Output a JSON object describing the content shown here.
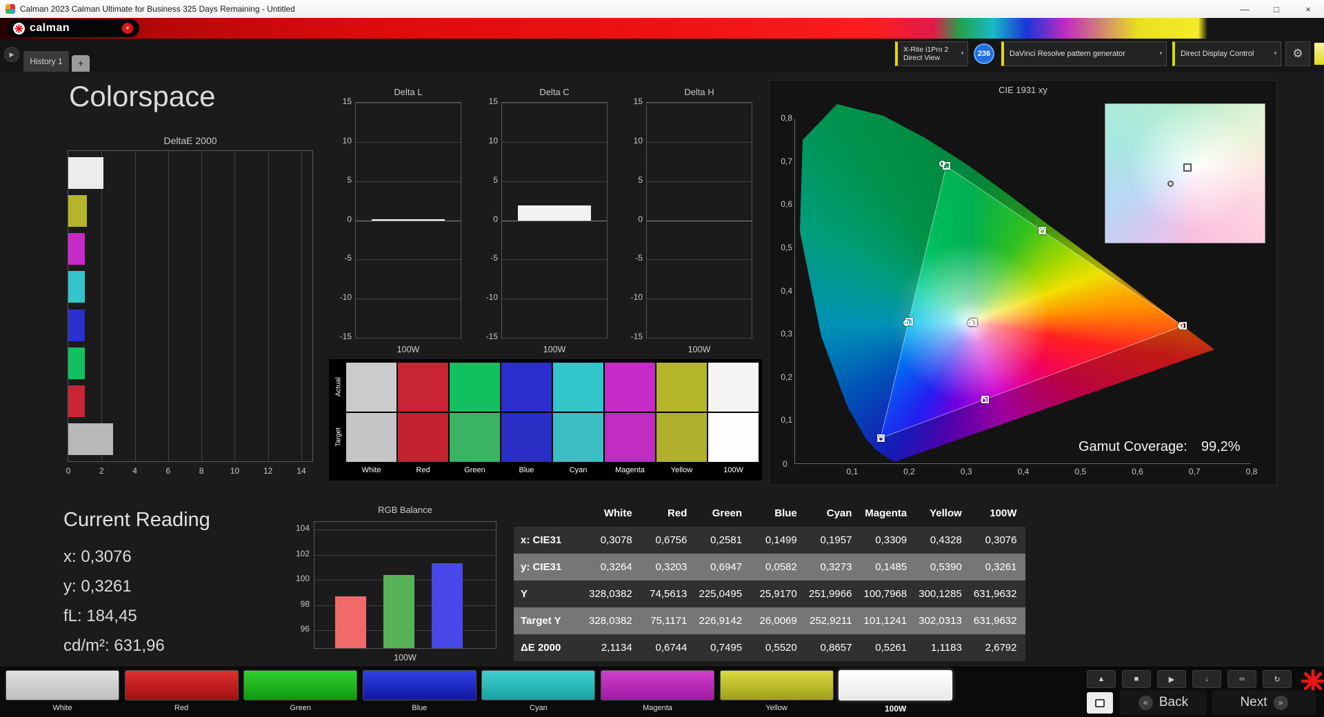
{
  "titlebar": {
    "title": "Calman 2023 Calman Ultimate for Business 325 Days Remaining  - Untitled",
    "minimize_glyph": "—",
    "maximize_glyph": "□",
    "close_glyph": "×"
  },
  "logo": {
    "text": "calman"
  },
  "tabs": {
    "history": "History 1",
    "add": "+"
  },
  "toolbar": {
    "meter": {
      "line1": "X-Rite i1Pro 2",
      "line2": "Direct View"
    },
    "badge": "236",
    "pattern_generator": "DaVinci Resolve pattern generator",
    "display_control": "Direct Display Control"
  },
  "icons": {
    "chevron_down": "▼",
    "play": "▶",
    "gear": "⚙",
    "back_chevrons": "«",
    "next_chevrons": "»"
  },
  "page": {
    "title": "Colorspace"
  },
  "current_reading": {
    "title": "Current Reading",
    "lines": [
      {
        "label": "x:",
        "value": "0,3076"
      },
      {
        "label": "y:",
        "value": "0,3261"
      },
      {
        "label": "fL:",
        "value": "184,45"
      },
      {
        "label": "cd/m²:",
        "value": "631,96"
      }
    ]
  },
  "swatch_comparison": {
    "row_labels": [
      "Actual",
      "Target"
    ],
    "columns": [
      {
        "label": "White",
        "actual": "#cbcbcb",
        "target": "#c5c5c5"
      },
      {
        "label": "Red",
        "actual": "#c92433",
        "target": "#c32331"
      },
      {
        "label": "Green",
        "actual": "#12c05f",
        "target": "#3ab463"
      },
      {
        "label": "Blue",
        "actual": "#2b2fcd",
        "target": "#2a2ec4"
      },
      {
        "label": "Cyan",
        "actual": "#32c5c9",
        "target": "#3cbec2"
      },
      {
        "label": "Magenta",
        "actual": "#c72bc7",
        "target": "#c12cc1"
      },
      {
        "label": "Yellow",
        "actual": "#b5b52a",
        "target": "#b0b02d"
      },
      {
        "label": "100W",
        "actual": "#f4f4f4",
        "target": "#fdfdfd"
      }
    ]
  },
  "pattern_bar": {
    "buttons": [
      {
        "label": "White",
        "color1": "#e2e2e2",
        "color2": "#bdbdbd",
        "selected": false
      },
      {
        "label": "Red",
        "color1": "#e03030",
        "color2": "#a01010",
        "selected": false
      },
      {
        "label": "Green",
        "color1": "#30d030",
        "color2": "#109810",
        "selected": false
      },
      {
        "label": "Blue",
        "color1": "#3040e8",
        "color2": "#1018a0",
        "selected": false
      },
      {
        "label": "Cyan",
        "color1": "#40d0d0",
        "color2": "#18a0a0",
        "selected": false
      },
      {
        "label": "Magenta",
        "color1": "#d040d0",
        "color2": "#a018a0",
        "selected": false
      },
      {
        "label": "Yellow",
        "color1": "#d8d840",
        "color2": "#a0a018",
        "selected": false
      },
      {
        "label": "100W",
        "color1": "#ffffff",
        "color2": "#e8e8e8",
        "selected": true
      }
    ]
  },
  "transport": {
    "buttons": [
      {
        "name": "up-arrow",
        "glyph": "▲"
      },
      {
        "name": "stop",
        "glyph": "■"
      },
      {
        "name": "play",
        "glyph": "▶"
      },
      {
        "name": "save",
        "glyph": "↓"
      },
      {
        "name": "link",
        "glyph": "∞"
      },
      {
        "name": "refresh",
        "glyph": "↻"
      }
    ],
    "back_label": "Back",
    "next_label": "Next"
  },
  "chart_data": [
    {
      "id": "deltaE2000",
      "type": "bar",
      "orientation": "horizontal",
      "title": "DeltaE 2000",
      "categories": [
        "White",
        "Yellow",
        "Magenta",
        "Cyan",
        "Blue",
        "Green",
        "Red",
        "100W"
      ],
      "values": [
        2.1134,
        1.1183,
        0.5261,
        0.8657,
        0.552,
        0.7495,
        0.6744,
        2.6792
      ],
      "colors": [
        "#ececec",
        "#b5b52a",
        "#c72bc7",
        "#32c5c9",
        "#2b2fcd",
        "#12c05f",
        "#c92433",
        "#b8b8b8"
      ],
      "xlim": [
        0,
        14
      ],
      "xticks": [
        0,
        2,
        4,
        6,
        8,
        10,
        12,
        14
      ],
      "grid": true
    },
    {
      "id": "deltaL",
      "type": "bar",
      "title": "Delta L",
      "categories": [
        "100W"
      ],
      "values": [
        0.12
      ],
      "ylim": [
        -15,
        15
      ],
      "yticks": [
        15,
        10,
        5,
        0,
        -5,
        -10,
        -15
      ],
      "xlabel": "100W",
      "bar_color": "#f2f2f2"
    },
    {
      "id": "deltaC",
      "type": "bar",
      "title": "Delta C",
      "categories": [
        "100W"
      ],
      "values": [
        1.9
      ],
      "ylim": [
        -15,
        15
      ],
      "yticks": [
        15,
        10,
        5,
        0,
        -5,
        -10,
        -15
      ],
      "xlabel": "100W",
      "bar_color": "#f2f2f2"
    },
    {
      "id": "deltaH",
      "type": "bar",
      "title": "Delta H",
      "categories": [
        "100W"
      ],
      "values": [
        0.0
      ],
      "ylim": [
        -15,
        15
      ],
      "yticks": [
        15,
        10,
        5,
        0,
        -5,
        -10,
        -15
      ],
      "xlabel": "100W",
      "bar_color": "#f2f2f2"
    },
    {
      "id": "rgbBalance",
      "type": "bar",
      "title": "RGB Balance",
      "categories": [
        "Red",
        "Green",
        "Blue"
      ],
      "values": [
        98.7,
        100.4,
        101.3
      ],
      "colors": [
        "#f06a6a",
        "#58b258",
        "#4848e8"
      ],
      "ylim": [
        94.6,
        104.6
      ],
      "yticks": [
        96,
        98,
        100,
        102,
        104
      ],
      "xlabel": "100W",
      "grid": true
    },
    {
      "id": "cie1931",
      "type": "scatter",
      "title": "CIE 1931 xy",
      "xlim": [
        0,
        0.8
      ],
      "ylim": [
        0,
        0.8
      ],
      "ticks": [
        0.1,
        0.2,
        0.3,
        0.4,
        0.5,
        0.6,
        0.7,
        0.8
      ],
      "origin_label": "0",
      "gamut_triangle": [
        [
          0.68,
          0.32
        ],
        [
          0.265,
          0.69
        ],
        [
          0.15,
          0.06
        ]
      ],
      "points": [
        {
          "name": "White",
          "measured": [
            0.3078,
            0.3264
          ],
          "target": [
            0.3127,
            0.329
          ]
        },
        {
          "name": "Red",
          "measured": [
            0.6756,
            0.3203
          ],
          "target": [
            0.68,
            0.32
          ]
        },
        {
          "name": "Green",
          "measured": [
            0.2581,
            0.6947
          ],
          "target": [
            0.265,
            0.69
          ]
        },
        {
          "name": "Blue",
          "measured": [
            0.1499,
            0.0582
          ],
          "target": [
            0.15,
            0.06
          ]
        },
        {
          "name": "Cyan",
          "measured": [
            0.1957,
            0.3273
          ],
          "target": [
            0.2,
            0.33
          ]
        },
        {
          "name": "Magenta",
          "measured": [
            0.3309,
            0.1485
          ],
          "target": [
            0.333,
            0.15
          ]
        },
        {
          "name": "Yellow",
          "measured": [
            0.4328,
            0.539
          ],
          "target": [
            0.433,
            0.54
          ]
        },
        {
          "name": "100W",
          "measured": [
            0.3076,
            0.3261
          ],
          "target": [
            0.3127,
            0.329
          ]
        }
      ],
      "gamut_coverage_label": "Gamut Coverage:",
      "gamut_coverage_value": "99,2%"
    },
    {
      "id": "measurement_table",
      "type": "table",
      "columns": [
        "White",
        "Red",
        "Green",
        "Blue",
        "Cyan",
        "Magenta",
        "Yellow",
        "100W"
      ],
      "rows": [
        {
          "label": "x: CIE31",
          "values": [
            "0,3078",
            "0,6756",
            "0,2581",
            "0,1499",
            "0,1957",
            "0,3309",
            "0,4328",
            "0,3076"
          ]
        },
        {
          "label": "y: CIE31",
          "values": [
            "0,3264",
            "0,3203",
            "0,6947",
            "0,0582",
            "0,3273",
            "0,1485",
            "0,5390",
            "0,3261"
          ]
        },
        {
          "label": "Y",
          "values": [
            "328,0382",
            "74,5613",
            "225,0495",
            "25,9170",
            "251,9966",
            "100,7968",
            "300,1285",
            "631,9632"
          ]
        },
        {
          "label": "Target Y",
          "values": [
            "328,0382",
            "75,1171",
            "226,9142",
            "26,0069",
            "252,9211",
            "101,1241",
            "302,0313",
            "631,9632"
          ]
        },
        {
          "label": "ΔE 2000",
          "values": [
            "2,1134",
            "0,6744",
            "0,7495",
            "0,5520",
            "0,8657",
            "0,5261",
            "1,1183",
            "2,6792"
          ]
        }
      ]
    }
  ]
}
